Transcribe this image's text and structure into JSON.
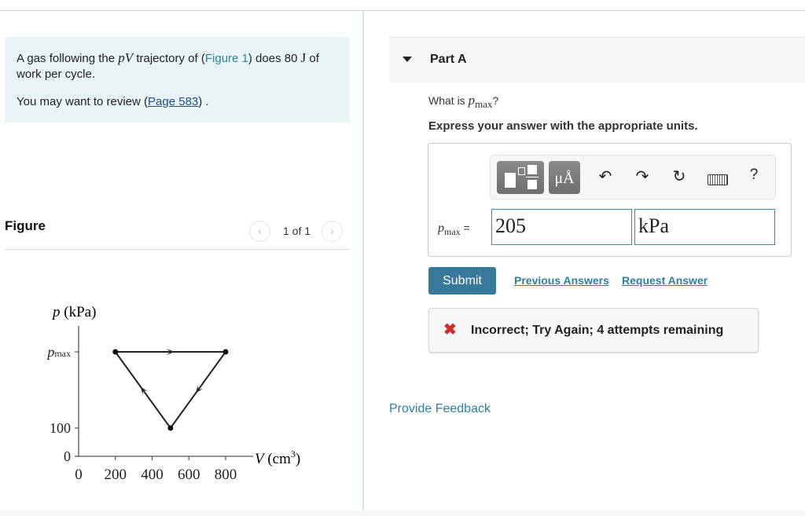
{
  "problem": {
    "text_before_math": "A gas following the ",
    "math_pV": "pV",
    "text_mid": " trajectory of (",
    "figure_link": "Figure 1",
    "text_after_link": ") does 80 ",
    "unit_J": "J",
    "text_end": " of work per cycle.",
    "review_prefix": "You may want to review (",
    "review_link": "Page 583",
    "review_suffix": ") ."
  },
  "figure": {
    "header": "Figure",
    "pager": "1 of 1",
    "prev_icon": "chevron-left",
    "next_icon": "chevron-right"
  },
  "chart_data": {
    "type": "line",
    "title": "",
    "xlabel": "V (cm³)",
    "ylabel": "p (kPa)",
    "x_ticks": [
      0,
      200,
      400,
      600,
      800
    ],
    "y_tick_labels": [
      "0",
      "100",
      "p_max"
    ],
    "xlim": [
      0,
      950
    ],
    "points": [
      {
        "V": 200,
        "p": "p_max"
      },
      {
        "V": 800,
        "p": "p_max"
      },
      {
        "V": 500,
        "p": 100
      },
      {
        "V": 200,
        "p": "p_max"
      }
    ],
    "direction": "clockwise: (200,pmax) -> (800,pmax) -> (500,100) -> (200,pmax)",
    "grid": false
  },
  "part": {
    "label": "Part A",
    "question_prefix": "What is ",
    "question_var": "p",
    "question_sub": "max",
    "question_suffix": "?",
    "instruction": "Express your answer with the appropriate units."
  },
  "toolbar": {
    "templates_icon": "templates-icon",
    "units_label": "μÅ",
    "undo_icon": "↶",
    "redo_icon": "↷",
    "reset_icon": "↻",
    "keyboard_icon": "keyboard",
    "help_label": "?"
  },
  "answer": {
    "label_var": "p",
    "label_sub": "max",
    "label_eq": " =",
    "value": "205",
    "units": "kPa"
  },
  "actions": {
    "submit": "Submit",
    "previous_answers": "Previous Answers",
    "request_answer": "Request Answer"
  },
  "feedback": {
    "icon": "✖",
    "message": "Incorrect; Try Again; 4 attempts remaining",
    "status_color": "#d42b2b"
  },
  "provide_feedback": "Provide Feedback"
}
